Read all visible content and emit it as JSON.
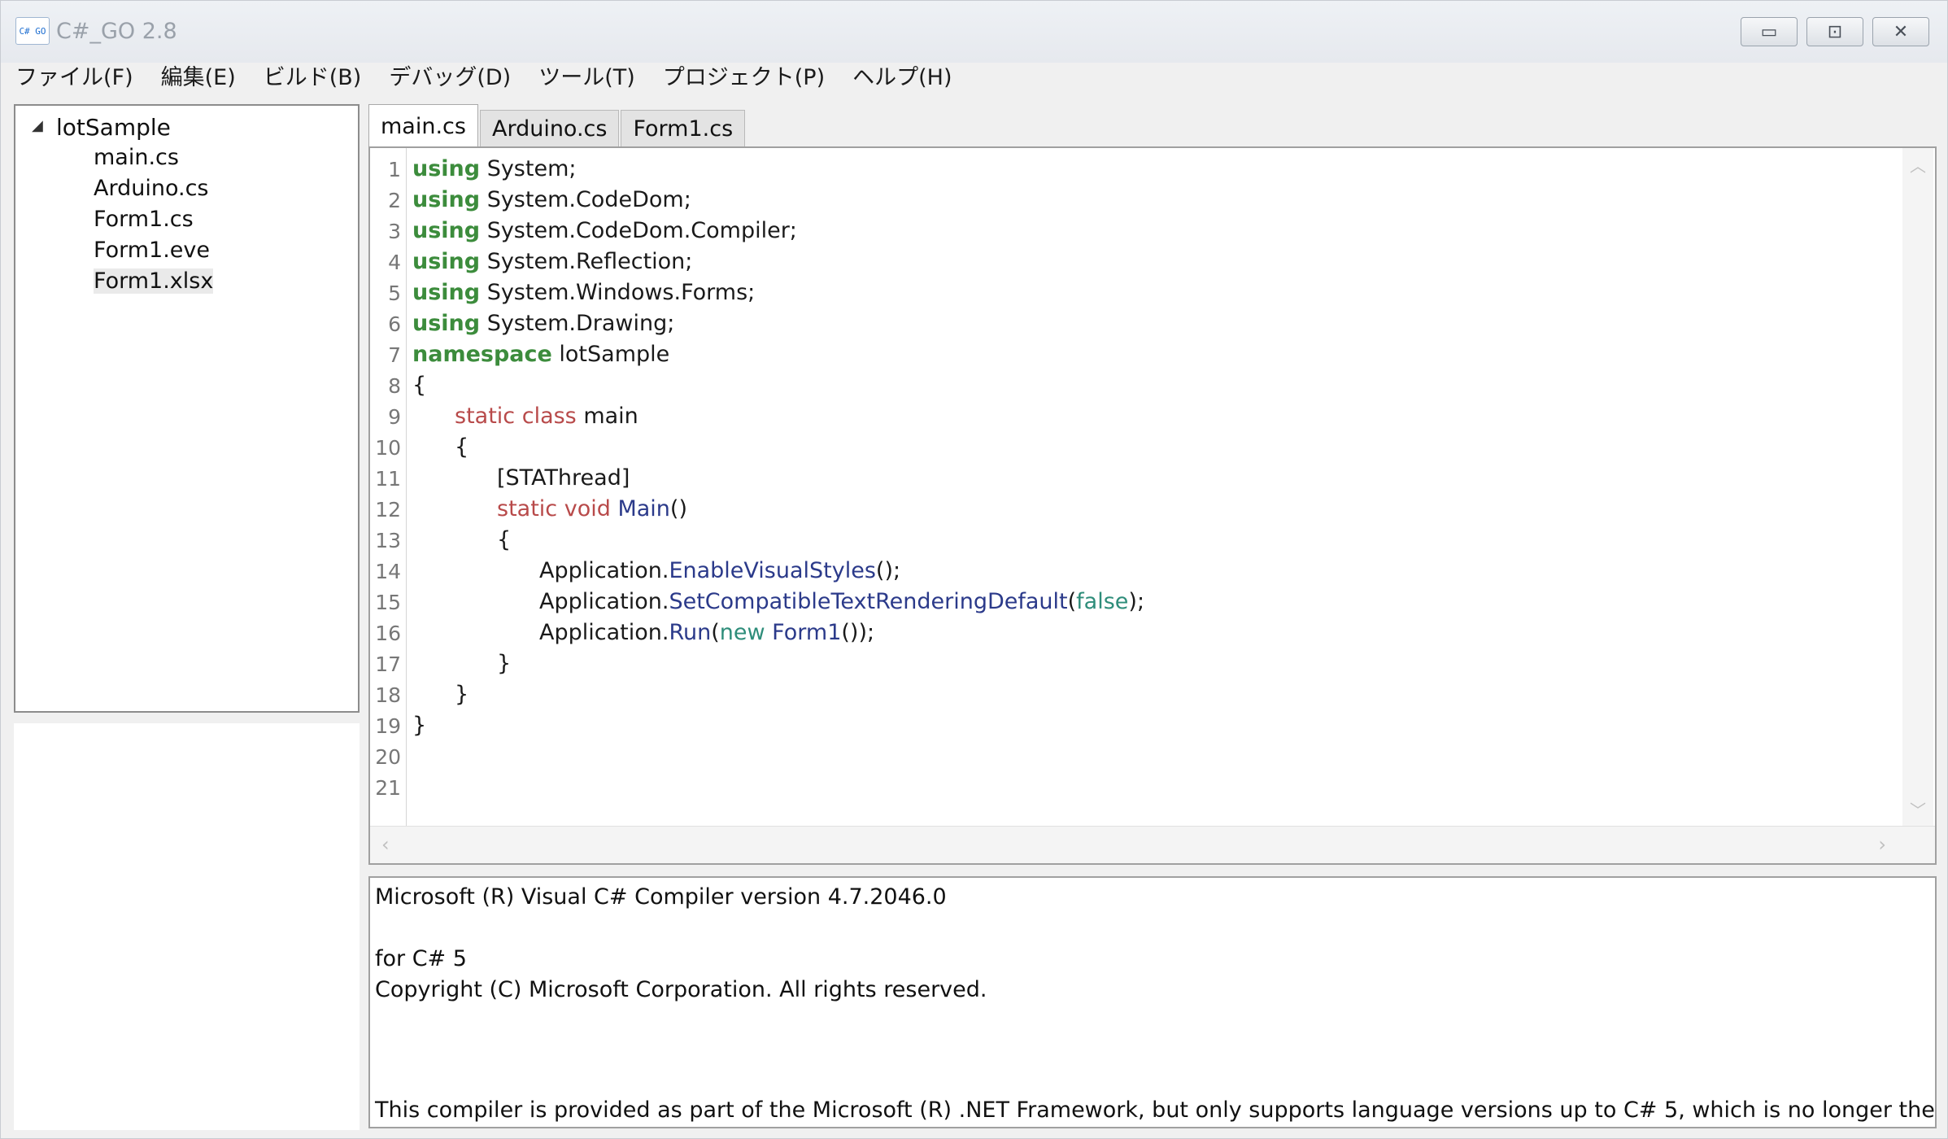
{
  "window": {
    "icon_text": "C# GO",
    "title": "C#_GO  2.8",
    "controls": {
      "minimize": "▭",
      "maximize": "⊡",
      "close": "✕"
    }
  },
  "menu": [
    "ファイル(F)",
    "編集(E)",
    "ビルド(B)",
    "デバッグ(D)",
    "ツール(T)",
    "プロジェクト(P)",
    "ヘルプ(H)"
  ],
  "tree": {
    "toggle": "◢",
    "root": "lotSample",
    "children": [
      "main.cs",
      "Arduino.cs",
      "Form1.cs",
      "Form1.eve",
      "Form1.xlsx"
    ],
    "selected": "Form1.xlsx"
  },
  "tabs": [
    "main.cs",
    "Arduino.cs",
    "Form1.cs"
  ],
  "active_tab": "main.cs",
  "editor": {
    "line_numbers": [
      "1",
      "2",
      "3",
      "4",
      "5",
      "6",
      "7",
      "8",
      "9",
      "10",
      "11",
      "12",
      "13",
      "14",
      "15",
      "16",
      "17",
      "18",
      "19",
      "20",
      "21"
    ],
    "code": {
      "l1": [
        "using",
        " System;"
      ],
      "l2": [
        "using",
        " System.CodeDom;"
      ],
      "l3": [
        "using",
        " System.CodeDom.Compiler;"
      ],
      "l4": [
        "using",
        " System.Reflection;"
      ],
      "l5": [
        "using",
        " System.Windows.Forms;"
      ],
      "l6": [
        "using",
        " System.Drawing;"
      ],
      "l7": [
        "namespace",
        " lotSample"
      ],
      "l8": "{",
      "l9": [
        "static",
        " class",
        " main"
      ],
      "l10": "{",
      "l11": "[STAThread]",
      "l12": [
        "static",
        " void",
        " Main",
        "()"
      ],
      "l13": "{",
      "l14": [
        "Application.",
        "EnableVisualStyles",
        "();"
      ],
      "l15": [
        "Application.",
        "SetCompatibleTextRenderingDefault",
        "(",
        "false",
        ");"
      ],
      "l16": [
        "Application.",
        "Run",
        "(",
        "new",
        " Form1",
        "());"
      ],
      "l17": "}",
      "l18": "}",
      "l19": "}"
    },
    "scroll": {
      "up": "︿",
      "down": "﹀",
      "left": "‹",
      "right": "›"
    }
  },
  "output": [
    "Microsoft (R) Visual C# Compiler version 4.7.2046.0",
    "for C# 5",
    "Copyright (C) Microsoft Corporation. All rights reserved.",
    "This compiler is provided as part of the Microsoft (R) .NET Framework, but only supports language versions up to C# 5, which is no longer the latest versio"
  ],
  "colors": {
    "keyword": "#3c8c3c",
    "modifier": "#b84a4a",
    "method": "#2b3a8a",
    "literal": "#2e8d7a"
  }
}
